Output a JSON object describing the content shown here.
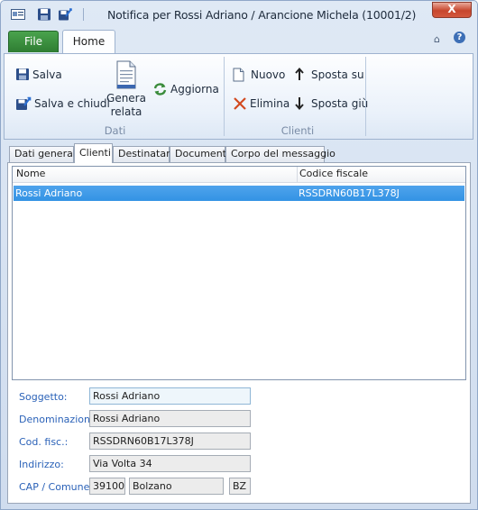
{
  "window": {
    "title": "Notifica per Rossi Adriano / Arancione Michela (10001/2)",
    "close_label": "X"
  },
  "quick_access": {
    "icons": [
      "form-icon",
      "save-icon",
      "save-close-icon"
    ]
  },
  "ribbon": {
    "file_tab": "File",
    "home_tab": "Home",
    "collapse_glyph": "⌂",
    "help_glyph": "?",
    "groups": {
      "dati": {
        "label": "Dati",
        "salva": "Salva",
        "salva_chiudi": "Salva e chiudi",
        "genera_relata_line1": "Genera",
        "genera_relata_line2": "relata",
        "aggiorna": "Aggiorna"
      },
      "clienti": {
        "label": "Clienti",
        "nuovo": "Nuovo",
        "elimina": "Elimina",
        "sposta_su": "Sposta su",
        "sposta_giu": "Sposta giù"
      }
    }
  },
  "tabs": [
    {
      "label": "Dati generali",
      "active": false
    },
    {
      "label": "Clienti",
      "active": true
    },
    {
      "label": "Destinatari",
      "active": false
    },
    {
      "label": "Documenti",
      "active": false
    },
    {
      "label": "Corpo del messaggio",
      "active": false
    }
  ],
  "grid": {
    "columns": [
      "Nome",
      "Codice fiscale"
    ],
    "rows": [
      {
        "nome": "Rossi Adriano",
        "codice_fiscale": "RSSDRN60B17L378J",
        "selected": true
      }
    ]
  },
  "form": {
    "soggetto": {
      "label": "Soggetto:",
      "value": "Rossi Adriano"
    },
    "denominazione": {
      "label": "Denominazione:",
      "value": "Rossi Adriano"
    },
    "cod_fisc": {
      "label": "Cod. fisc.:",
      "value": "RSSDRN60B17L378J"
    },
    "indirizzo": {
      "label": "Indirizzo:",
      "value": "Via  Volta 34"
    },
    "cap_comune": {
      "label": "CAP / Comune:",
      "cap": "39100",
      "comune": "Bolzano",
      "provincia": "BZ"
    }
  },
  "colors": {
    "file_tab": "#2e7d32",
    "selection": "#3393e4",
    "form_label": "#2b62b8",
    "close_button": "#c7462d"
  }
}
